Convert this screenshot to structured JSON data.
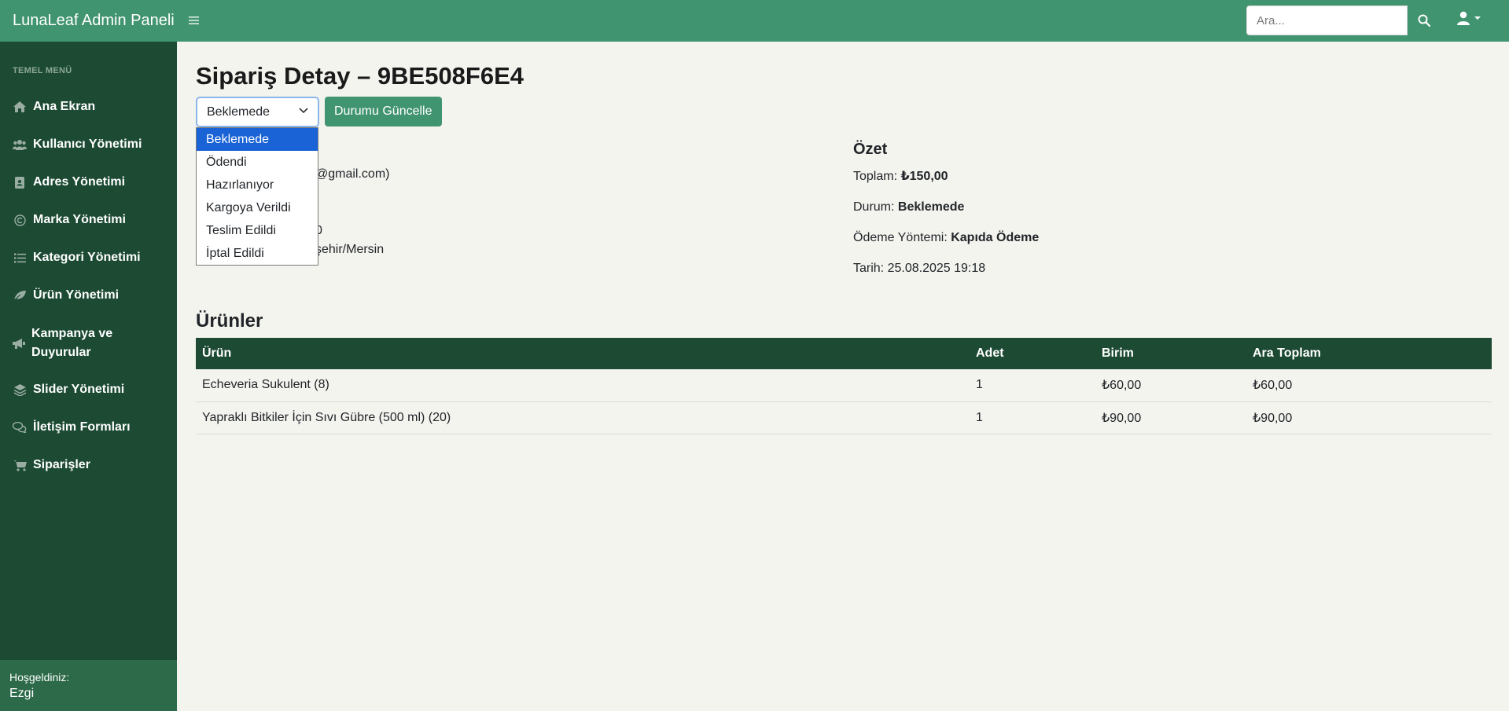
{
  "app": {
    "brand": "LunaLeaf Admin Paneli",
    "search_placeholder": "Ara..."
  },
  "sidebar": {
    "heading": "TEMEL MENÜ",
    "items": [
      {
        "label": "Ana Ekran",
        "icon": "home-icon"
      },
      {
        "label": "Kullanıcı Yönetimi",
        "icon": "users-icon"
      },
      {
        "label": "Adres Yönetimi",
        "icon": "address-book-icon"
      },
      {
        "label": "Marka Yönetimi",
        "icon": "copyright-icon"
      },
      {
        "label": "Kategori Yönetimi",
        "icon": "list-icon"
      },
      {
        "label": "Ürün Yönetimi",
        "icon": "leaf-icon"
      },
      {
        "label": "Kampanya ve Duyurular",
        "icon": "megaphone-icon"
      },
      {
        "label": "Slider Yönetimi",
        "icon": "layers-icon"
      },
      {
        "label": "İletişim Formları",
        "icon": "comments-icon"
      },
      {
        "label": "Siparişler",
        "icon": "cart-icon"
      }
    ],
    "footer": {
      "greeting": "Hoşgeldiniz:",
      "username": "Ezgi"
    }
  },
  "main": {
    "title": "Sipariş Detay – 9BE508F6E4",
    "status_select": {
      "selected": "Beklemede",
      "options": [
        "Beklemede",
        "Ödendi",
        "Hazırlanıyor",
        "Kargoya Verildi",
        "Teslim Edildi",
        "İptal Edildi"
      ]
    },
    "update_button": "Durumu Güncelle",
    "customer_visible": {
      "email_fragment": "@gmail.com)",
      "phone_fragment": "0",
      "address_fragment": "şehir/Mersin"
    },
    "summary": {
      "title": "Özet",
      "total_label": "Toplam:",
      "total_value": "₺150,00",
      "status_label": "Durum:",
      "status_value": "Beklemede",
      "payment_label": "Ödeme Yöntemi:",
      "payment_value": "Kapıda Ödeme",
      "date_label": "Tarih:",
      "date_value": "25.08.2025 19:18"
    },
    "products": {
      "title": "Ürünler",
      "columns": [
        "Ürün",
        "Adet",
        "Birim",
        "Ara Toplam"
      ],
      "rows": [
        [
          "Echeveria Sukulent (8)",
          "1",
          "₺60,00",
          "₺60,00"
        ],
        [
          "Yapraklı Bitkiler İçin Sıvı Gübre (500 ml) (20)",
          "1",
          "₺90,00",
          "₺90,00"
        ]
      ]
    }
  },
  "colors": {
    "navbar": "#419470",
    "sidebar": "#1c4a33",
    "sidebar_footer": "#2d6a49",
    "table_header": "#1c4a33",
    "dropdown_active": "#1a63d6"
  }
}
